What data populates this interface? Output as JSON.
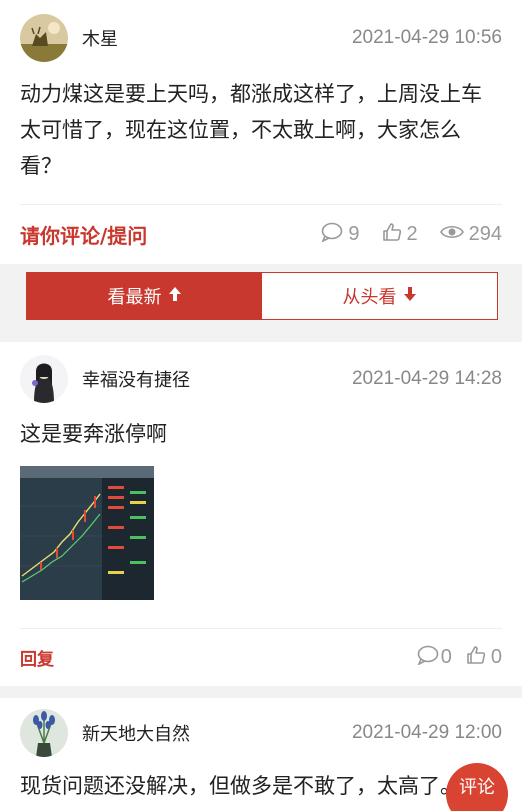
{
  "post": {
    "username": "木星",
    "time": "2021-04-29 10:56",
    "content": "动力煤这是要上天吗，都涨成这样了，上周没上车太可惜了，现在这位置，不太敢上啊，大家怎么看？",
    "comment_link": "请你评论/提问",
    "comments": "9",
    "likes": "2",
    "views": "294"
  },
  "tabs": {
    "latest": "看最新",
    "from_start": "从头看"
  },
  "replies": [
    {
      "username": "幸福没有捷径",
      "time": "2021-04-29 14:28",
      "content": "这是要奔涨停啊",
      "reply_link": "回复",
      "comments": "0",
      "likes": "0"
    },
    {
      "username": "新天地大自然",
      "time": "2021-04-29 12:00",
      "content": "现货问题还没解决，但做多是不敢了，太高了。"
    }
  ],
  "fab": {
    "label": "评论"
  },
  "colors": {
    "accent": "#c8382e",
    "muted": "#999999"
  }
}
